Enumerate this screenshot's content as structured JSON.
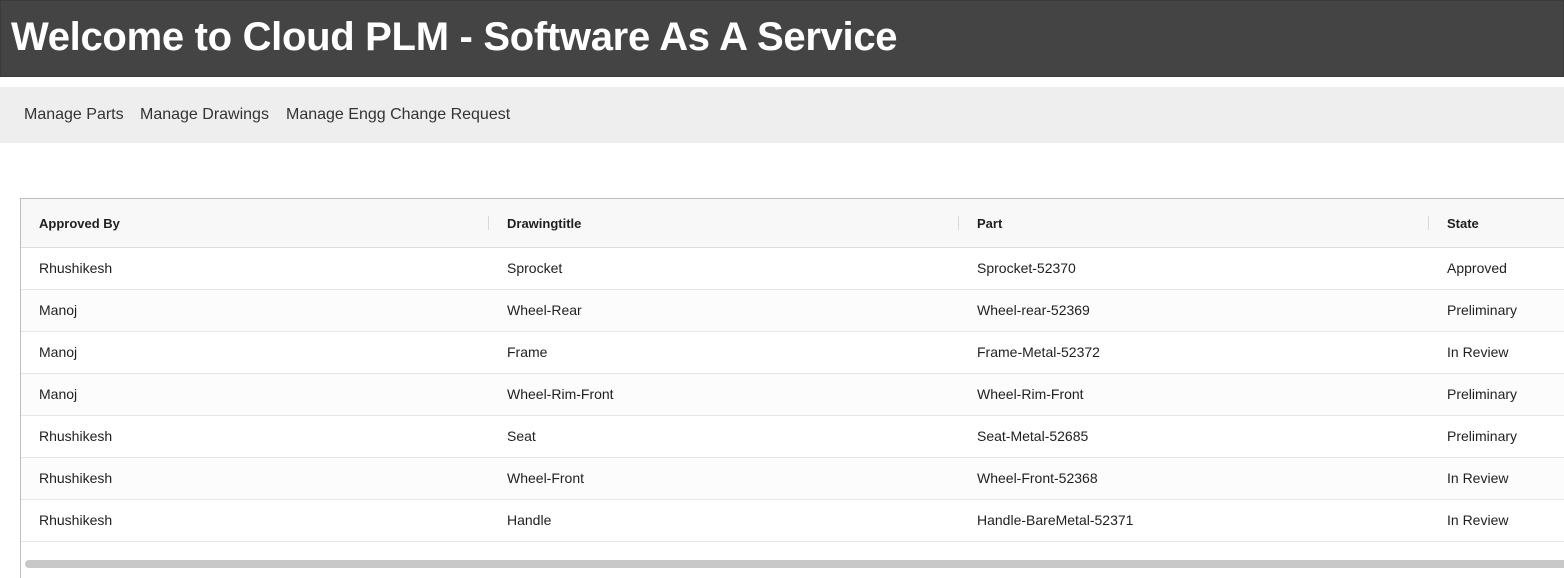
{
  "header": {
    "title": "Welcome to Cloud PLM - Software As A Service"
  },
  "nav": {
    "items": [
      {
        "label": "Manage Parts"
      },
      {
        "label": "Manage Drawings"
      },
      {
        "label": "Manage Engg Change Request"
      }
    ]
  },
  "table": {
    "columns": [
      "Approved By",
      "Drawingtitle",
      "Part",
      "State"
    ],
    "rows": [
      [
        "Rhushikesh",
        "Sprocket",
        "Sprocket-52370",
        "Approved"
      ],
      [
        "Manoj",
        "Wheel-Rear",
        "Wheel-rear-52369",
        "Preliminary"
      ],
      [
        "Manoj",
        "Frame",
        "Frame-Metal-52372",
        "In Review"
      ],
      [
        "Manoj",
        "Wheel-Rim-Front",
        "Wheel-Rim-Front",
        "Preliminary"
      ],
      [
        "Rhushikesh",
        "Seat",
        "Seat-Metal-52685",
        "Preliminary"
      ],
      [
        "Rhushikesh",
        "Wheel-Front",
        "Wheel-Front-52368",
        "In Review"
      ],
      [
        "Rhushikesh",
        "Handle",
        "Handle-BareMetal-52371",
        "In Review"
      ]
    ]
  },
  "colors": {
    "header_bg": "#444444",
    "nav_bg": "#eeeeee",
    "grid_header_bg": "#f8f8f8"
  }
}
